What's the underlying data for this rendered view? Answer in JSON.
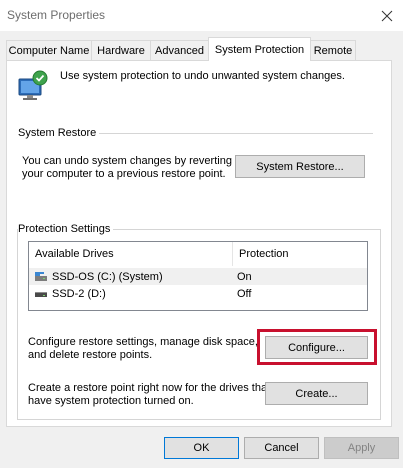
{
  "window": {
    "title": "System Properties"
  },
  "tabs": [
    {
      "label": "Computer Name"
    },
    {
      "label": "Hardware"
    },
    {
      "label": "Advanced"
    },
    {
      "label": "System Protection"
    },
    {
      "label": "Remote"
    }
  ],
  "intro": {
    "text": "Use system protection to undo unwanted system changes."
  },
  "system_restore": {
    "group_label": "System Restore",
    "description_line1": "You can undo system changes by reverting",
    "description_line2": "your computer to a previous restore point.",
    "button_label": "System Restore..."
  },
  "protection_settings": {
    "group_label": "Protection Settings",
    "columns": [
      "Available Drives",
      "Protection"
    ],
    "drives": [
      {
        "name": "SSD-OS (C:) (System)",
        "protection": "On"
      },
      {
        "name": "SSD-2 (D:)",
        "protection": "Off"
      }
    ],
    "configure_text_line1": "Configure restore settings, manage disk space,",
    "configure_text_line2": "and delete restore points.",
    "configure_button": "Configure...",
    "create_text_line1": "Create a restore point right now for the drives that",
    "create_text_line2": "have system protection turned on.",
    "create_button": "Create..."
  },
  "footer": {
    "ok": "OK",
    "cancel": "Cancel",
    "apply": "Apply"
  },
  "colors": {
    "highlight": "#c8102e",
    "panel_bg": "#ffffff",
    "dialog_bg": "#f0f0f0"
  },
  "icons": {
    "close": "close-icon",
    "shield": "system-protection-icon",
    "drive_system": "system-drive-icon",
    "drive": "drive-icon"
  }
}
